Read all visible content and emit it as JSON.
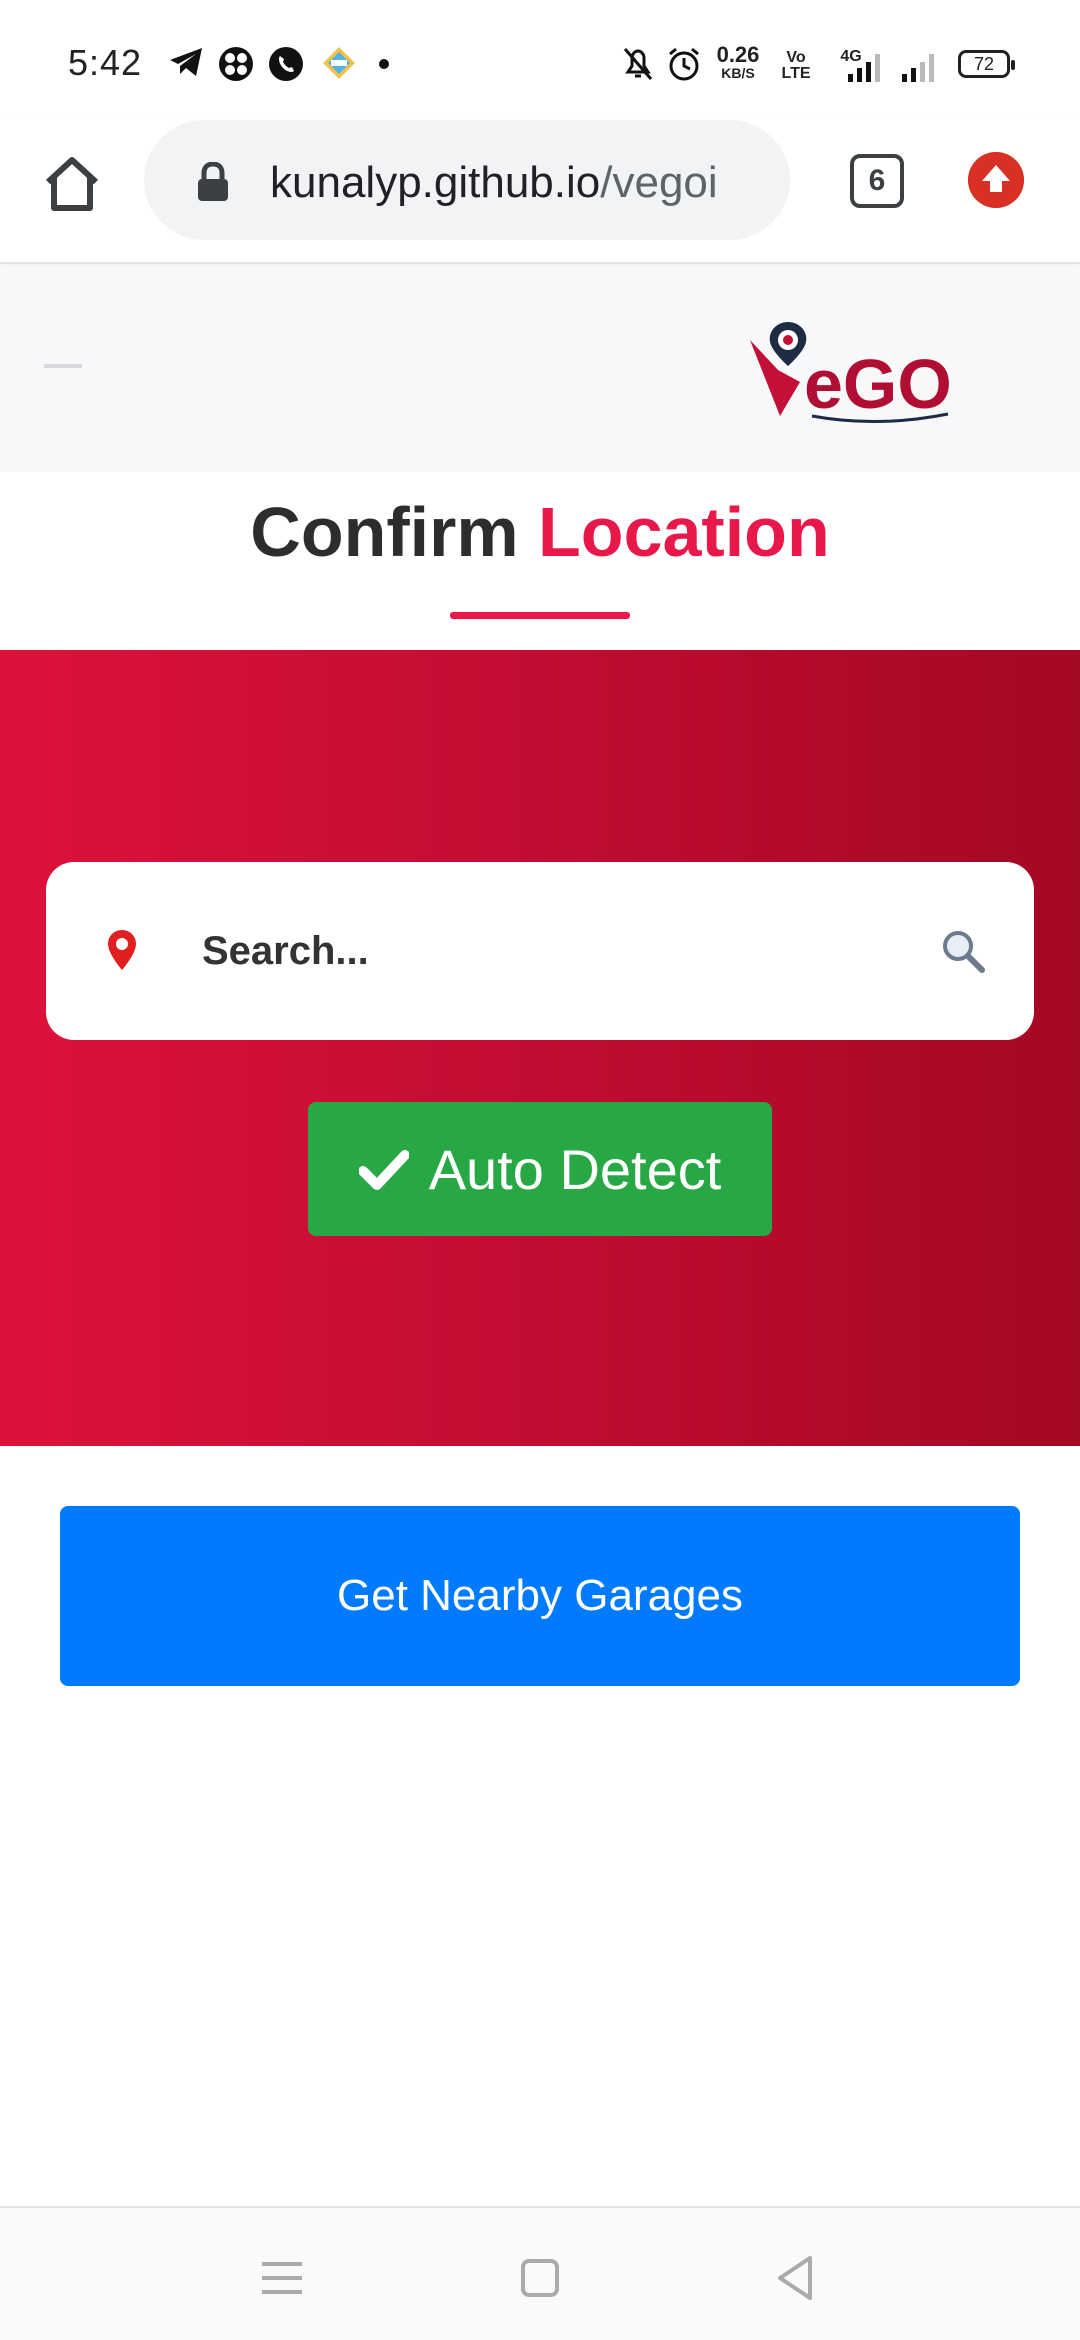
{
  "status_bar": {
    "time": "5:42",
    "network_speed": "0.26",
    "network_unit": "KB/S",
    "volte": "Vo LTE",
    "network_type": "4G",
    "battery": "72"
  },
  "browser": {
    "url_domain": "kunalyp.github.io",
    "url_path": "/vegoi",
    "tab_count": "6"
  },
  "header": {
    "logo_text": "eGO"
  },
  "title": {
    "part1": "Confirm",
    "part2": "Location"
  },
  "search": {
    "placeholder": "Search..."
  },
  "auto_detect": {
    "label": "Auto Detect"
  },
  "nearby": {
    "label": "Get Nearby Garages"
  },
  "colors": {
    "accent": "#e8184a",
    "hero_gradient_start": "#dc123c",
    "hero_gradient_end": "#a30824",
    "success": "#28a745",
    "primary": "#007bff"
  }
}
